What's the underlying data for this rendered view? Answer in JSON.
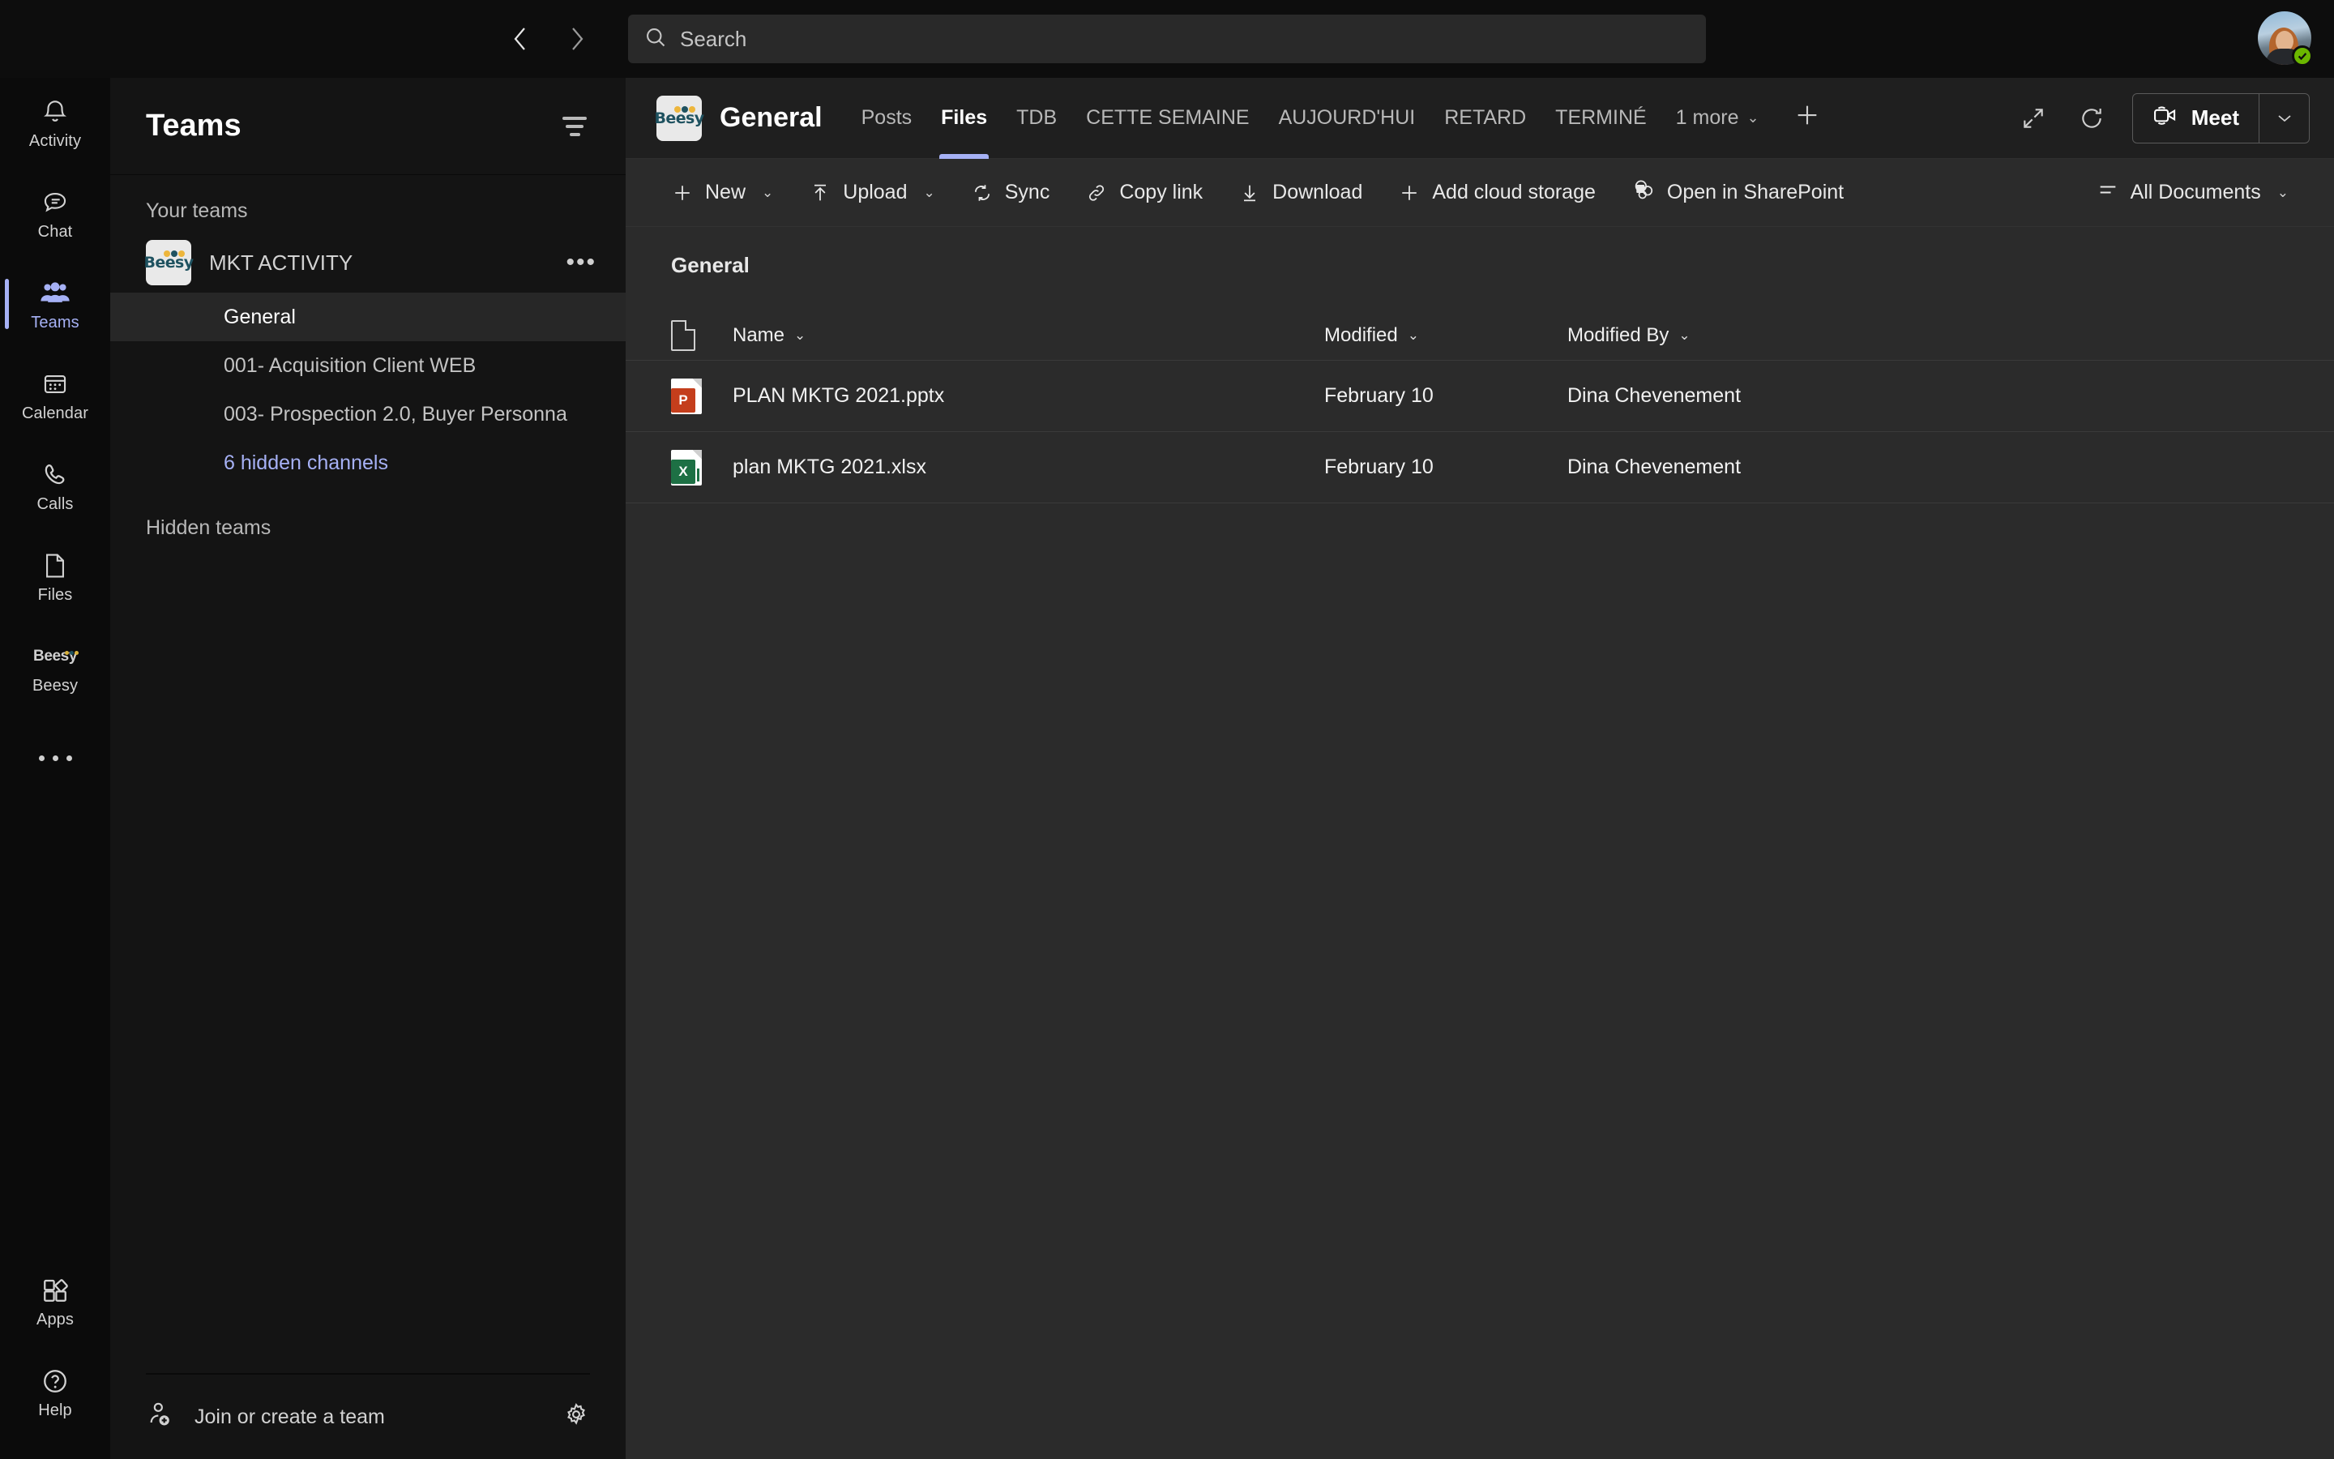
{
  "titlebar": {
    "back_icon": "chevron-left-icon",
    "forward_icon": "chevron-right-icon",
    "search_placeholder": "Search",
    "search_value": "",
    "search_icon": "search-icon",
    "avatar_status": "available"
  },
  "rail": {
    "items": [
      {
        "label": "Activity",
        "icon": "bell-icon",
        "active": false
      },
      {
        "label": "Chat",
        "icon": "chat-bubble-icon",
        "active": false
      },
      {
        "label": "Teams",
        "icon": "people-icon",
        "active": true
      },
      {
        "label": "Calendar",
        "icon": "calendar-icon",
        "active": false
      },
      {
        "label": "Calls",
        "icon": "phone-icon",
        "active": false
      },
      {
        "label": "Files",
        "icon": "file-icon",
        "active": false
      },
      {
        "label": "Beesy",
        "icon": "beesy-app-icon",
        "active": false
      }
    ],
    "more_icon": "ellipsis-icon",
    "bottom": [
      {
        "label": "Apps",
        "icon": "apps-icon"
      },
      {
        "label": "Help",
        "icon": "help-icon"
      }
    ]
  },
  "teams_panel": {
    "title": "Teams",
    "filter_icon": "filter-icon",
    "your_teams_label": "Your teams",
    "team": {
      "name": "MKT ACTIVITY",
      "logo_text": "Beesy",
      "more_icon": "ellipsis-icon"
    },
    "channels": [
      {
        "label": "General",
        "active": true,
        "link": false
      },
      {
        "label": "001- Acquisition Client WEB",
        "active": false,
        "link": false
      },
      {
        "label": "003- Prospection 2.0, Buyer Personna",
        "active": false,
        "link": false
      },
      {
        "label": "6 hidden channels",
        "active": false,
        "link": true
      }
    ],
    "hidden_teams_label": "Hidden teams",
    "join_label": "Join or create a team",
    "join_icon": "add-person-icon",
    "settings_icon": "gear-icon"
  },
  "channel_header": {
    "logo_text": "Beesy",
    "title": "General",
    "tabs": [
      {
        "label": "Posts",
        "active": false
      },
      {
        "label": "Files",
        "active": true
      },
      {
        "label": "TDB",
        "active": false
      },
      {
        "label": "CETTE SEMAINE",
        "active": false
      },
      {
        "label": "AUJOURD'HUI",
        "active": false
      },
      {
        "label": "RETARD",
        "active": false
      },
      {
        "label": "TERMINÉ",
        "active": false
      }
    ],
    "more_tabs_label": "1 more",
    "add_tab_icon": "plus-icon",
    "expand_icon": "expand-diagonal-icon",
    "refresh_icon": "refresh-icon",
    "meet_label": "Meet",
    "meet_icon": "video-camera-icon",
    "meet_caret_icon": "chevron-down-icon"
  },
  "command_bar": {
    "items": [
      {
        "label": "New",
        "icon": "plus-icon",
        "has_caret": true
      },
      {
        "label": "Upload",
        "icon": "upload-arrow-icon",
        "has_caret": true
      },
      {
        "label": "Sync",
        "icon": "sync-icon",
        "has_caret": false
      },
      {
        "label": "Copy link",
        "icon": "link-icon",
        "has_caret": false
      },
      {
        "label": "Download",
        "icon": "download-arrow-icon",
        "has_caret": false
      },
      {
        "label": "Add cloud storage",
        "icon": "plus-icon",
        "has_caret": false
      },
      {
        "label": "Open in SharePoint",
        "icon": "sharepoint-icon",
        "has_caret": false
      }
    ],
    "view_label": "All Documents",
    "view_icon": "list-view-icon",
    "view_caret_icon": "chevron-down-icon"
  },
  "files": {
    "breadcrumb": "General",
    "columns": {
      "icon": "document-icon",
      "name": "Name",
      "modified": "Modified",
      "modified_by": "Modified By"
    },
    "rows": [
      {
        "name": "PLAN MKTG 2021.pptx",
        "modified": "February 10",
        "modified_by": "Dina Chevenement",
        "type": "powerpoint",
        "badge": "P"
      },
      {
        "name": "plan MKTG 2021.xlsx",
        "modified": "February 10",
        "modified_by": "Dina Chevenement",
        "type": "excel",
        "badge": "X"
      }
    ]
  },
  "colors": {
    "accent": "#a6b1f5",
    "rail_bg": "#0b0b0b",
    "panel_bg": "#141414",
    "main_bg": "#1f1f1f",
    "content_bg": "#2b2b2b",
    "status_available": "#6bb700",
    "powerpoint": "#c43e1c",
    "excel": "#1d7044"
  }
}
